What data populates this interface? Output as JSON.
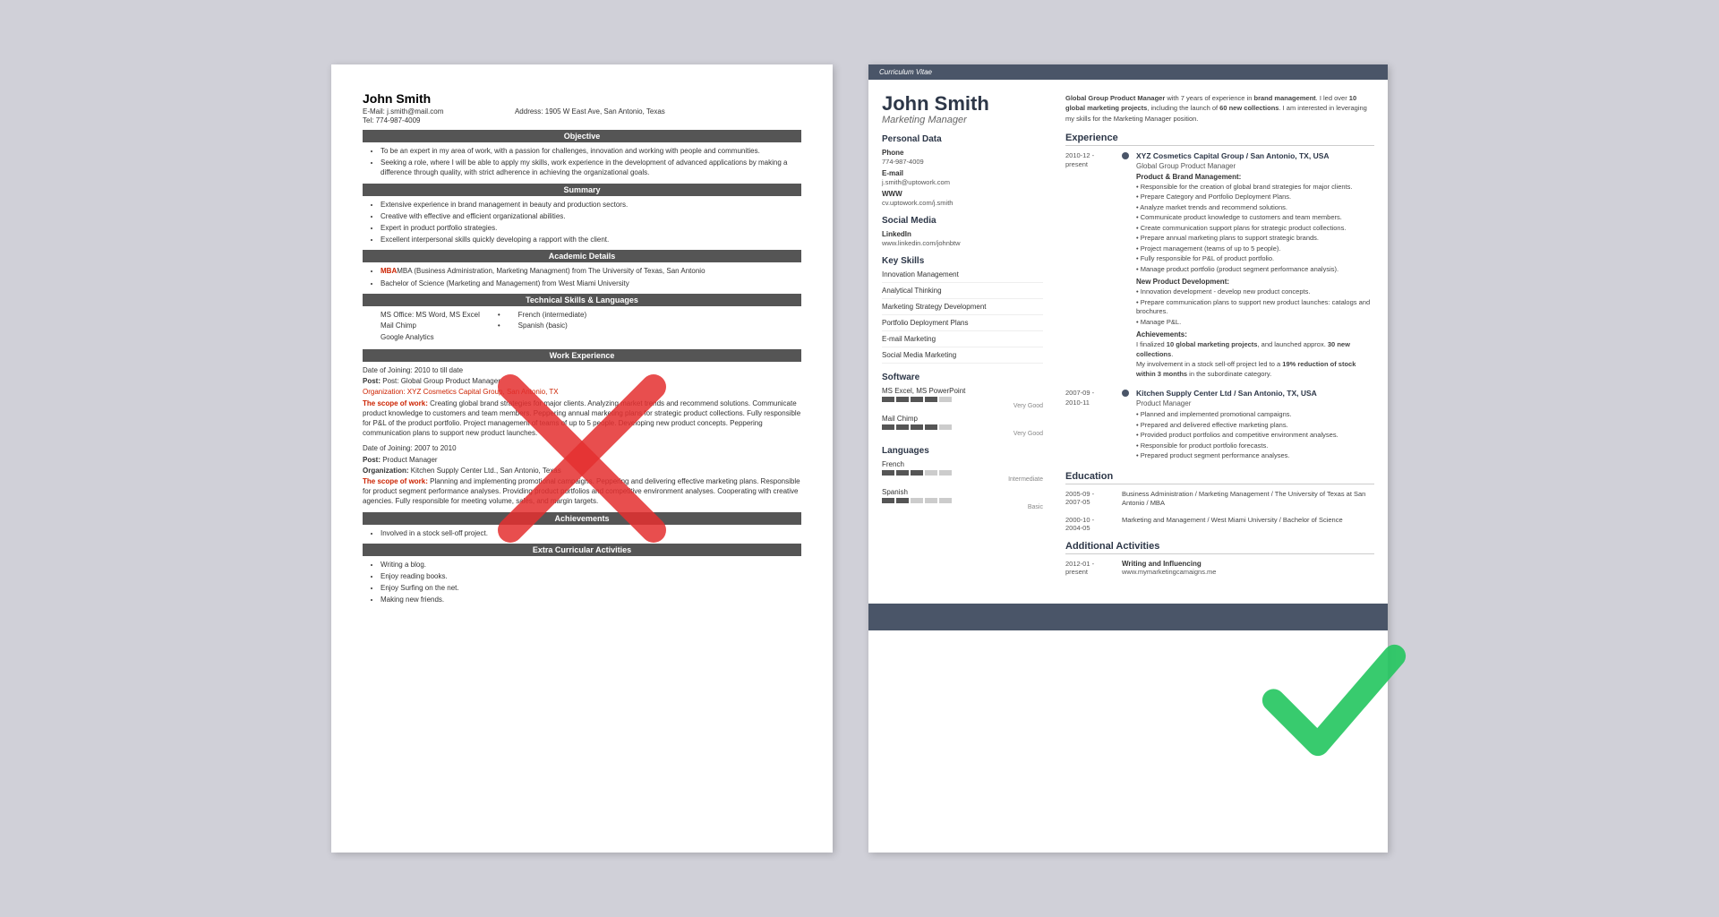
{
  "left_resume": {
    "name": "John Smith",
    "email_label": "E-Mail:",
    "email": "j.smith@mail.com",
    "tel_label": "Tel:",
    "tel": "774-987-4009",
    "address_label": "Address:",
    "address": "1905 W East Ave, San Antonio, Texas",
    "sections": {
      "objective": {
        "title": "Objective",
        "bullets": [
          "To be an expert in my area of work, with a passion for challenges, innovation and working with people and communities.",
          "Seeking a role, where I will be able to apply my skills, work experience in the development of advanced applications by making a difference through quality, with strict adherence in achieving the organizational goals."
        ]
      },
      "summary": {
        "title": "Summary",
        "bullets": [
          "Extensive experience in brand management in beauty and production sectors.",
          "Creative with effective and efficient organizational abilities.",
          "Expert in product portfolio strategies.",
          "Excellent interpersonal skills quickly developing a rapport with the client."
        ]
      },
      "academic": {
        "title": "Academic Details",
        "bullets": [
          "MBA (Business Administration, Marketing Managment) from The University of Texas, San Antonio",
          "Bachelor of Science (Marketing and Management) from West Miami University"
        ]
      },
      "technical": {
        "title": "Technical Skills & Languages",
        "left_items": [
          "MS Office: MS Word, MS Excel",
          "Mail Chimp",
          "Google Analytics"
        ],
        "right_items": [
          "French (intermediate)",
          "Spanish (basic)"
        ]
      },
      "work": {
        "title": "Work Experience",
        "entries": [
          {
            "date_joining": "Date of Joining: 2010 to till date",
            "post": "Post: Global Group Product Manager",
            "org": "Organization: XYZ Cosmetics Capital Group, San Antonio, TX",
            "scope_label": "The scope of work:",
            "scope": "Creating global brand strategies for major clients. Analyzing market trends and recommend solutions. Communicate product knowledge to customers and team members. Peppering annual marketing plans for strategic product collections. Fully responsible for P&L of the product portfolio. Project management of teams of up to 5 people. Developing new product concepts. Peppering communication plans to support new product launches."
          },
          {
            "date_joining": "Date of Joining: 2007 to 2010",
            "post": "Post: Product Manager",
            "org": "Organization: Kitchen Supply Center Ltd., San Antonio, Texas",
            "scope_label": "The scope of work:",
            "scope": "Planning and implementing promotional campaigns. Peppering and delivering effective marketing plans. Responsible for product segment performance analyses. Providing product portfolios and competitive environment analyses. Cooperating with creative agencies. Fully responsible for meeting volume, sales, and margin targets."
          }
        ]
      },
      "achievements": {
        "title": "Achievements",
        "bullets": [
          "Involved in a stock sell-off project."
        ]
      },
      "extra": {
        "title": "Extra Curricular Activities",
        "bullets": [
          "Writing a blog.",
          "Enjoy reading books.",
          "Enjoy Surfing on the net.",
          "Making new friends."
        ]
      }
    }
  },
  "right_resume": {
    "cv_label": "Curriculum Vitae",
    "name": "John Smith",
    "title": "Marketing Manager",
    "intro": "Global Group Product Manager with 7 years of experience in brand management. I led over 10 global marketing projects, including the launch of 60 new collections. I am interested in leveraging my skills for the Marketing Manager position.",
    "personal_data": {
      "title": "Personal Data",
      "phone_label": "Phone",
      "phone": "774-987-4009",
      "email_label": "E-mail",
      "email": "j.smith@uptowork.com",
      "www_label": "WWW",
      "www": "cv.uptowork.com/j.smith"
    },
    "social_media": {
      "title": "Social Media",
      "linkedin_label": "LinkedIn",
      "linkedin": "www.linkedin.com/johnbtw"
    },
    "key_skills": {
      "title": "Key Skills",
      "items": [
        "Innovation Management",
        "Analytical Thinking",
        "Marketing Strategy Development",
        "Portfolio Deployment Plans",
        "E-mail Marketing",
        "Social Media Marketing"
      ]
    },
    "software": {
      "title": "Software",
      "items": [
        {
          "name": "MS Excel, MS PowerPoint",
          "level": 4,
          "label": "Very Good"
        },
        {
          "name": "Mail Chimp",
          "level": 4,
          "label": "Very Good"
        }
      ]
    },
    "languages": {
      "title": "Languages",
      "items": [
        {
          "name": "French",
          "level": 3,
          "total": 5,
          "label": "Intermediate"
        },
        {
          "name": "Spanish",
          "level": 2,
          "total": 5,
          "label": "Basic"
        }
      ]
    },
    "experience": {
      "title": "Experience",
      "entries": [
        {
          "date": "2010-12 - present",
          "org": "XYZ Cosmetics Capital Group / San Antonio, TX, USA",
          "role": "Global Group Product Manager",
          "sections": [
            {
              "label": "Product & Brand Management:",
              "bullets": [
                "Responsible for the creation of global brand strategies for major clients.",
                "Prepare Category and Portfolio Deployment Plans.",
                "Analyze market trends and recommend solutions.",
                "Communicate product knowledge to customers and team members.",
                "Create communication support plans for strategic product collections.",
                "Prepare annual marketing plans to support strategic brands.",
                "Project management (teams of up to 5 people).",
                "Fully responsible for P&L of product portfolio.",
                "Manage product portfolio (product segment performance analysis)."
              ]
            },
            {
              "label": "New Product Development:",
              "bullets": [
                "Innovation development - develop new product concepts.",
                "Prepare communication plans to support new product launches: catalogs and brochures.",
                "Manage P&L."
              ]
            },
            {
              "label": "Achievements:",
              "achievement_text": "I finalized 10 global marketing projects, and launched approx. 30 new collections.",
              "achievement_text2": "My involvement in a stock sell-off project led to a 19% reduction of stock within 3 months in the subordinate category."
            }
          ]
        },
        {
          "date": "2007-09 - 2010-11",
          "org": "Kitchen Supply Center Ltd / San Antonio, TX, USA",
          "role": "Product Manager",
          "bullets": [
            "Planned and implemented promotional campaigns.",
            "Prepared and delivered effective marketing plans.",
            "Provided product portfolios and competitive environment analyses.",
            "Responsible for product portfolio forecasts.",
            "Prepared product segment performance analyses."
          ]
        }
      ]
    },
    "education": {
      "title": "Education",
      "entries": [
        {
          "date": "2005-09 - 2007-05",
          "content": "Business Administration / Marketing Management / The University of Texas at San Antonio / MBA"
        },
        {
          "date": "2000-10 - 2004-05",
          "content": "Marketing and Management / West Miami University / Bachelor of Science"
        }
      ]
    },
    "additional": {
      "title": "Additional Activities",
      "entries": [
        {
          "date": "2012-01 - present",
          "title": "Writing and Influencing",
          "value": "www.mymarketingcamaigns.me"
        }
      ]
    }
  }
}
